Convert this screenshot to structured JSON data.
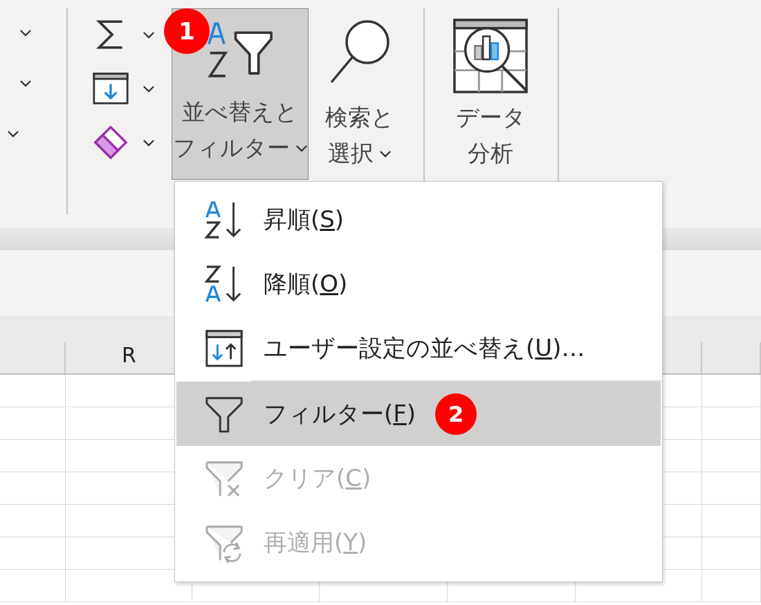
{
  "ribbon": {
    "buttons": [
      {
        "kind": "sort-filter",
        "line_1": "並べ替えと",
        "line_2": "フィルター",
        "selected": true,
        "dropdown": true
      },
      {
        "kind": "find-select",
        "line_1": "検索と",
        "line_2": "選択",
        "selected": false,
        "dropdown": true
      },
      {
        "kind": "data-analysis",
        "line_1": "データ",
        "line_2": "分析",
        "selected": false,
        "dropdown": false
      }
    ]
  },
  "callouts": [
    {
      "text": "1"
    },
    {
      "text": "2"
    }
  ],
  "menu": {
    "items": [
      {
        "kind": "sort-asc",
        "before": "昇順(",
        "accelerator": "S",
        "after": ")",
        "selected": false,
        "disabled": false
      },
      {
        "kind": "sort-desc",
        "before": "降順(",
        "accelerator": "O",
        "after": ")",
        "selected": false,
        "disabled": false
      },
      {
        "kind": "custom-sort",
        "before": "ユーザー設定の並べ替え(",
        "accelerator": "U",
        "after": ")…",
        "selected": false,
        "disabled": false
      },
      {
        "kind": "filter",
        "before": "フィルター(",
        "accelerator": "F",
        "after": ")",
        "selected": true,
        "disabled": false
      },
      {
        "kind": "clear",
        "before": "クリア(",
        "accelerator": "C",
        "after": ")",
        "selected": false,
        "disabled": true
      },
      {
        "kind": "reapply",
        "before": "再適用(",
        "accelerator": "Y",
        "after": ")",
        "selected": false,
        "disabled": true
      }
    ]
  },
  "sheet": {
    "column_headers": [
      "R"
    ]
  }
}
